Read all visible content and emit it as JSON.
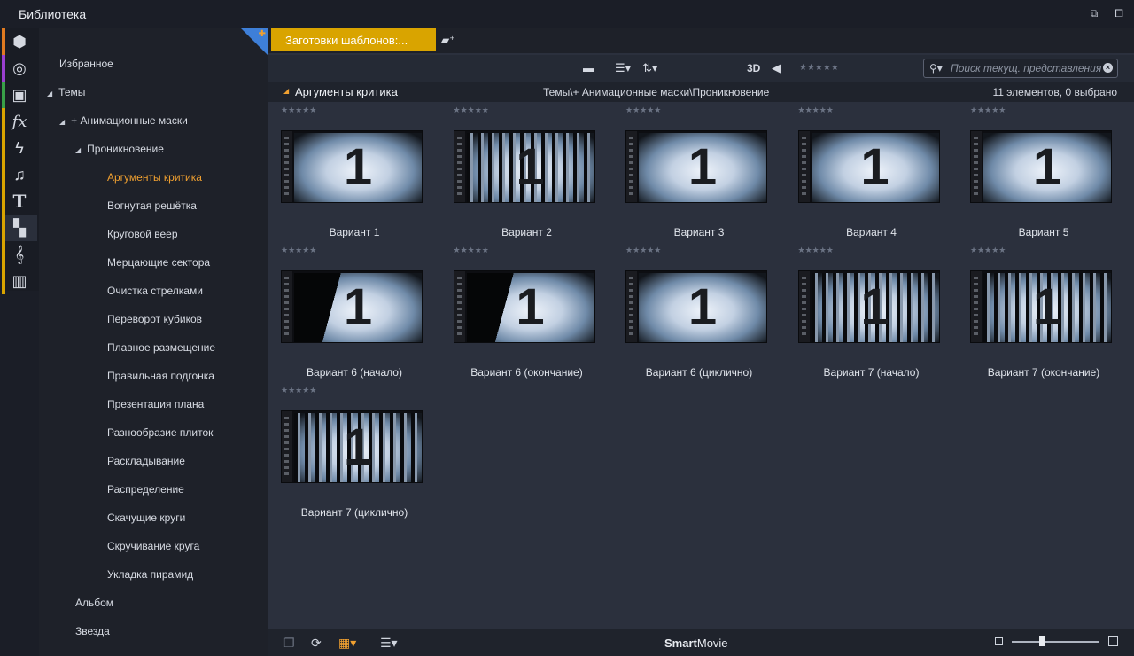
{
  "window": {
    "title": "Библиотека"
  },
  "iconbar": [
    {
      "icon": "box-icon",
      "glyph": "⬢",
      "color": "#e07a20"
    },
    {
      "icon": "film-reel-icon",
      "glyph": "◎",
      "color": "#9a3fd0"
    },
    {
      "icon": "stack-icon",
      "glyph": "▣",
      "color": "#38a048"
    },
    {
      "icon": "fx-icon",
      "glyph": "fx",
      "color": "#d9a400"
    },
    {
      "icon": "lightning-icon",
      "glyph": "ϟ",
      "color": "#d9a400"
    },
    {
      "icon": "music-note-icon",
      "glyph": "♫",
      "color": "#d9a400"
    },
    {
      "icon": "text-icon",
      "glyph": "T",
      "color": "#d9a400"
    },
    {
      "icon": "montage-icon",
      "glyph": "▚",
      "color": "#d9a400"
    },
    {
      "icon": "treble-clef-icon",
      "glyph": "𝄞",
      "color": "#d9a400"
    },
    {
      "icon": "piano-icon",
      "glyph": "▥",
      "color": "#d9a400"
    }
  ],
  "tree": {
    "items": [
      {
        "label": "Избранное",
        "level": 0,
        "arrow": ""
      },
      {
        "label": "Темы",
        "level": 0,
        "arrow": "◢"
      },
      {
        "label": "+ Анимационные маски",
        "level": 1,
        "arrow": "◢"
      },
      {
        "label": "Проникновение",
        "level": 2,
        "arrow": "◢"
      },
      {
        "label": "Аргументы критика",
        "level": 3,
        "arrow": "",
        "active": true
      },
      {
        "label": "Вогнутая решётка",
        "level": 3,
        "arrow": ""
      },
      {
        "label": "Круговой веер",
        "level": 3,
        "arrow": ""
      },
      {
        "label": "Мерцающие сектора",
        "level": 3,
        "arrow": ""
      },
      {
        "label": "Очистка стрелками",
        "level": 3,
        "arrow": ""
      },
      {
        "label": "Переворот кубиков",
        "level": 3,
        "arrow": ""
      },
      {
        "label": "Плавное размещение",
        "level": 3,
        "arrow": ""
      },
      {
        "label": "Правильная подгонка",
        "level": 3,
        "arrow": ""
      },
      {
        "label": "Презентация плана",
        "level": 3,
        "arrow": ""
      },
      {
        "label": "Разнообразие плиток",
        "level": 3,
        "arrow": ""
      },
      {
        "label": "Раскладывание",
        "level": 3,
        "arrow": ""
      },
      {
        "label": "Распределение",
        "level": 3,
        "arrow": ""
      },
      {
        "label": "Скачущие круги",
        "level": 3,
        "arrow": ""
      },
      {
        "label": "Скручивание круга",
        "level": 3,
        "arrow": ""
      },
      {
        "label": "Укладка пирамид",
        "level": 3,
        "arrow": ""
      },
      {
        "label": "Альбом",
        "level": 2,
        "arrow": ""
      },
      {
        "label": "Звезда",
        "level": 2,
        "arrow": ""
      }
    ]
  },
  "tabs": [
    {
      "label": "Заготовки шаблонов:..."
    }
  ],
  "toolbar": {
    "label_3d": "3D",
    "rating_stars": "★★★★★",
    "search_placeholder": "Поиск текущ. представления"
  },
  "pathbar": {
    "section": "Аргументы критика",
    "path": "Темы\\+ Анимационные маски\\Проникновение",
    "count": "11 элементов, 0 выбрано"
  },
  "items": [
    {
      "caption": "Вариант 1",
      "number": "1",
      "style": "plain",
      "stars": "★★★★★"
    },
    {
      "caption": "Вариант 2",
      "number": "1",
      "style": "bars",
      "stars": "★★★★★"
    },
    {
      "caption": "Вариант 3",
      "number": "1",
      "style": "plain",
      "stars": "★★★★★"
    },
    {
      "caption": "Вариант 4",
      "number": "1",
      "style": "plain",
      "stars": "★★★★★"
    },
    {
      "caption": "Вариант 5",
      "number": "1",
      "style": "plain",
      "stars": "★★★★★"
    },
    {
      "caption": "Вариант 6 (начало)",
      "number": "1",
      "style": "split",
      "stars": "★★★★★"
    },
    {
      "caption": "Вариант 6 (окончание)",
      "number": "1",
      "style": "split",
      "stars": "★★★★★"
    },
    {
      "caption": "Вариант 6 (циклично)",
      "number": "1",
      "style": "plain",
      "stars": "★★★★★"
    },
    {
      "caption": "Вариант 7 (начало)",
      "number": "1",
      "style": "bars",
      "stars": "★★★★★"
    },
    {
      "caption": "Вариант 7 (окончание)",
      "number": "1",
      "style": "bars",
      "stars": "★★★★★"
    },
    {
      "caption": "Вариант 7 (циклично)",
      "number": "1",
      "style": "bars",
      "stars": "★★★★★"
    }
  ],
  "statusbar": {
    "brand_bold": "Smart",
    "brand_rest": "Movie"
  },
  "colors": {
    "accent": "#d9a400",
    "active_text": "#f0a030",
    "pin": "#3e7fd8"
  }
}
